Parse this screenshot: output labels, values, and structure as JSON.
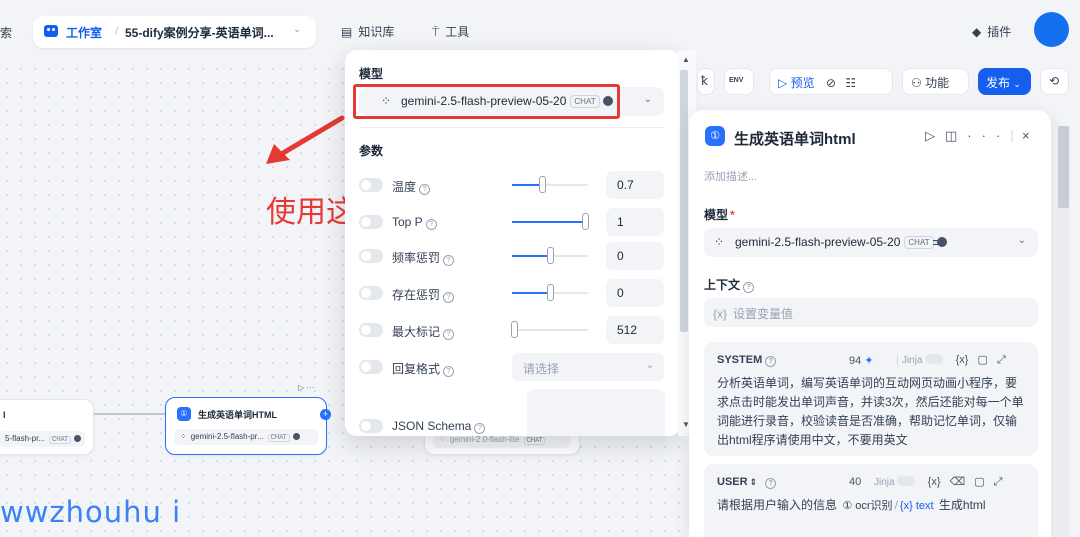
{
  "topbar": {
    "left_cut_text": "索",
    "studio_label": "工作室",
    "app_name": "55-dify案例分享-英语单词...",
    "nav_knowledge": "知识库",
    "nav_tools": "工具",
    "plugins": "插件"
  },
  "canvas": {
    "node_left_title": "l",
    "node_left_model": "5-flash-pr...",
    "node_main_title": "生成英语单词HTML",
    "node_main_model": "gemini-2.5-flash-pr...",
    "node_right_model": "gemini-2.0-flash-lite",
    "chat_tag": "CHAT",
    "node_menu": "▷ ···",
    "annotation": "使用这个模型",
    "watermark": "wwzhouhu i"
  },
  "model_popover": {
    "section_model": "模型",
    "model_name": "gemini-2.5-flash-preview-05-20",
    "model_tag": "CHAT",
    "section_params": "参数",
    "params": [
      {
        "label": "温度",
        "value": "0.7",
        "ratio": 0.4
      },
      {
        "label": "Top P",
        "value": "1",
        "ratio": 1.0
      },
      {
        "label": "频率惩罚",
        "value": "0",
        "ratio": 0.5
      },
      {
        "label": "存在惩罚",
        "value": "0",
        "ratio": 0.5
      },
      {
        "label": "最大标记",
        "value": "512",
        "ratio": 0.0
      }
    ],
    "response_format_label": "回复格式",
    "response_format_placeholder": "请选择",
    "json_schema_label": "JSON Schema"
  },
  "toolbar": {
    "env": "ENV",
    "preview": "预览",
    "features": "功能",
    "publish": "发布"
  },
  "panel": {
    "title": "生成英语单词html",
    "desc_placeholder": "添加描述...",
    "model_label": "模型",
    "model_name": "gemini-2.5-flash-preview-05-20",
    "model_tag": "CHAT",
    "context_label": "上下文",
    "context_placeholder": "设置变量值",
    "system": {
      "title": "SYSTEM",
      "count": "94",
      "jinja": "Jinja",
      "text": "分析英语单词，编写英语单词的互动网页动画小程序，要求点击时能发出单词声音，并读3次，然后还能对每一个单词能进行录音，校验读音是否准确，帮助记忆单词，仅输出html程序请使用中文，不要用英文"
    },
    "user": {
      "title": "USER",
      "count": "40",
      "jinja": "Jinja",
      "text_prefix": "请根据用户输入的信息",
      "var_node": "ocr识别",
      "var_name": "text",
      "text_suffix": "生成html"
    }
  },
  "colors": {
    "accent": "#155eef",
    "annotation_red": "#e53935",
    "watermark_blue": "#3b82f6"
  }
}
